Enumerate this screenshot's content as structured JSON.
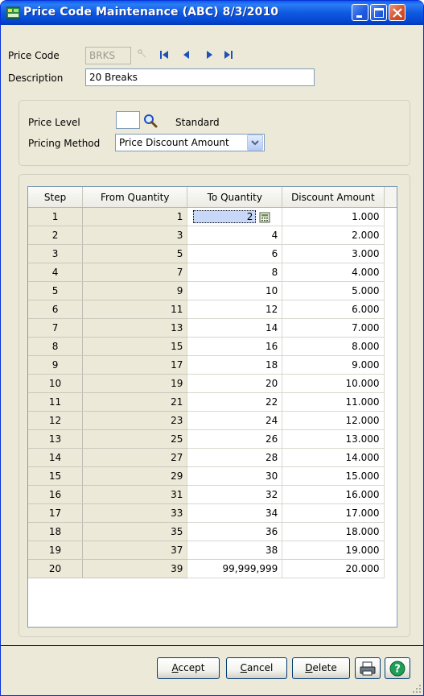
{
  "window": {
    "title": "Price Code Maintenance (ABC) 8/3/2010",
    "icon": "app-module-icon"
  },
  "header": {
    "price_code_label": "Price Code",
    "price_code_value": "BRKS",
    "description_label": "Description",
    "description_value": "20 Breaks"
  },
  "pricing": {
    "price_level_label": "Price Level",
    "price_level_value": "",
    "price_level_desc": "Standard",
    "pricing_method_label": "Pricing Method",
    "pricing_method_value": "Price Discount Amount"
  },
  "grid": {
    "columns": [
      "Step",
      "From Quantity",
      "To Quantity",
      "Discount Amount"
    ],
    "rows": [
      [
        "1",
        "1",
        "2",
        "1.000"
      ],
      [
        "2",
        "3",
        "4",
        "2.000"
      ],
      [
        "3",
        "5",
        "6",
        "3.000"
      ],
      [
        "4",
        "7",
        "8",
        "4.000"
      ],
      [
        "5",
        "9",
        "10",
        "5.000"
      ],
      [
        "6",
        "11",
        "12",
        "6.000"
      ],
      [
        "7",
        "13",
        "14",
        "7.000"
      ],
      [
        "8",
        "15",
        "16",
        "8.000"
      ],
      [
        "9",
        "17",
        "18",
        "9.000"
      ],
      [
        "10",
        "19",
        "20",
        "10.000"
      ],
      [
        "11",
        "21",
        "22",
        "11.000"
      ],
      [
        "12",
        "23",
        "24",
        "12.000"
      ],
      [
        "13",
        "25",
        "26",
        "13.000"
      ],
      [
        "14",
        "27",
        "28",
        "14.000"
      ],
      [
        "15",
        "29",
        "30",
        "15.000"
      ],
      [
        "16",
        "31",
        "32",
        "16.000"
      ],
      [
        "17",
        "33",
        "34",
        "17.000"
      ],
      [
        "18",
        "35",
        "36",
        "18.000"
      ],
      [
        "19",
        "37",
        "38",
        "19.000"
      ],
      [
        "20",
        "39",
        "99,999,999",
        "20.000"
      ]
    ]
  },
  "buttons": {
    "accept": {
      "mnemonic": "A",
      "rest": "ccept"
    },
    "cancel": {
      "mnemonic": "C",
      "rest": "ancel"
    },
    "delete": {
      "mnemonic": "D",
      "rest": "elete"
    }
  },
  "colors": {
    "titlebar": "#0A5DEB",
    "window_bg": "#ECE9D8",
    "selection": "#C8D8F8",
    "nav_arrows": "#1F4FB8"
  }
}
